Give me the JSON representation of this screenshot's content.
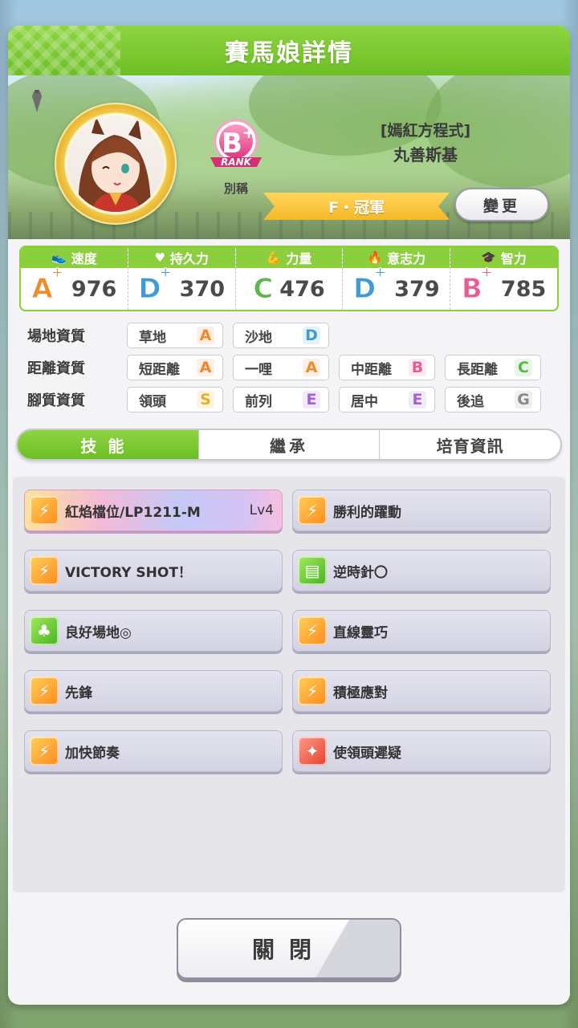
{
  "dialog": {
    "title": "賽馬娘詳情"
  },
  "hero": {
    "rank": {
      "grade": "B",
      "plus": "+",
      "label": "RANK",
      "caption": "別稱"
    },
    "alias": "[嫣紅方程式]",
    "name": "丸善斯基",
    "title": "F・冠軍",
    "change_label": "變更"
  },
  "stats": [
    {
      "label": "速度",
      "icon": "shoe-icon",
      "glyph": "👟",
      "grade": "A",
      "plus": "+",
      "value": "976",
      "color": "#f08a2b"
    },
    {
      "label": "持久力",
      "icon": "heart-icon",
      "glyph": "♥",
      "grade": "D",
      "plus": "+",
      "value": "370",
      "color": "#3f9ad8"
    },
    {
      "label": "力量",
      "icon": "muscle-icon",
      "glyph": "💪",
      "grade": "C",
      "plus": "",
      "value": "476",
      "color": "#5ab84a"
    },
    {
      "label": "意志力",
      "icon": "flame-icon",
      "glyph": "🔥",
      "grade": "D",
      "plus": "+",
      "value": "379",
      "color": "#3f9ad8"
    },
    {
      "label": "智力",
      "icon": "graduation-cap-icon",
      "glyph": "🎓",
      "grade": "B",
      "plus": "+",
      "value": "785",
      "color": "#e85b95"
    }
  ],
  "aptitudes": [
    {
      "label": "場地資質",
      "items": [
        {
          "name": "草地",
          "grade": "A",
          "color": "#f08a2b"
        },
        {
          "name": "沙地",
          "grade": "D",
          "color": "#3f9ad8"
        }
      ]
    },
    {
      "label": "距離資質",
      "items": [
        {
          "name": "短距離",
          "grade": "A",
          "color": "#f08a2b"
        },
        {
          "name": "一哩",
          "grade": "A",
          "color": "#f08a2b"
        },
        {
          "name": "中距離",
          "grade": "B",
          "color": "#e85b95"
        },
        {
          "name": "長距離",
          "grade": "C",
          "color": "#5ab84a"
        }
      ]
    },
    {
      "label": "腳質資質",
      "items": [
        {
          "name": "領頭",
          "grade": "S",
          "color": "#e6b020"
        },
        {
          "name": "前列",
          "grade": "E",
          "color": "#a063d6"
        },
        {
          "name": "居中",
          "grade": "E",
          "color": "#a063d6"
        },
        {
          "name": "後追",
          "grade": "G",
          "color": "#8a8a8a"
        }
      ]
    }
  ],
  "tabs": [
    {
      "label": "技能",
      "active": true
    },
    {
      "label": "繼承",
      "active": false
    },
    {
      "label": "培育資訊",
      "active": false
    }
  ],
  "skills": [
    {
      "name": "紅焰檔位/LP1211-M",
      "level": "Lv4",
      "unique": true,
      "icon": "speed-skill-icon",
      "color": "orange"
    },
    {
      "name": "勝利的躍動",
      "level": "",
      "unique": false,
      "icon": "speed-skill-icon",
      "color": "orange"
    },
    {
      "name": "VICTORY SHOT！",
      "level": "",
      "unique": false,
      "icon": "speed-skill-icon",
      "color": "orange"
    },
    {
      "name": "逆時針〇",
      "level": "",
      "unique": false,
      "icon": "card-skill-icon",
      "color": "green"
    },
    {
      "name": "良好場地◎",
      "level": "",
      "unique": false,
      "icon": "stamina-skill-icon",
      "color": "green"
    },
    {
      "name": "直線靈巧",
      "level": "",
      "unique": false,
      "icon": "speed-skill-icon",
      "color": "orange"
    },
    {
      "name": "先鋒",
      "level": "",
      "unique": false,
      "icon": "speed-skill-icon",
      "color": "orange"
    },
    {
      "name": "積極應對",
      "level": "",
      "unique": false,
      "icon": "speed-skill-icon",
      "color": "orange"
    },
    {
      "name": "加快節奏",
      "level": "",
      "unique": false,
      "icon": "speed-skill-icon",
      "color": "orange"
    },
    {
      "name": "使領頭遲疑",
      "level": "",
      "unique": false,
      "icon": "debuff-skill-icon",
      "color": "red"
    }
  ],
  "close_label": "關閉"
}
